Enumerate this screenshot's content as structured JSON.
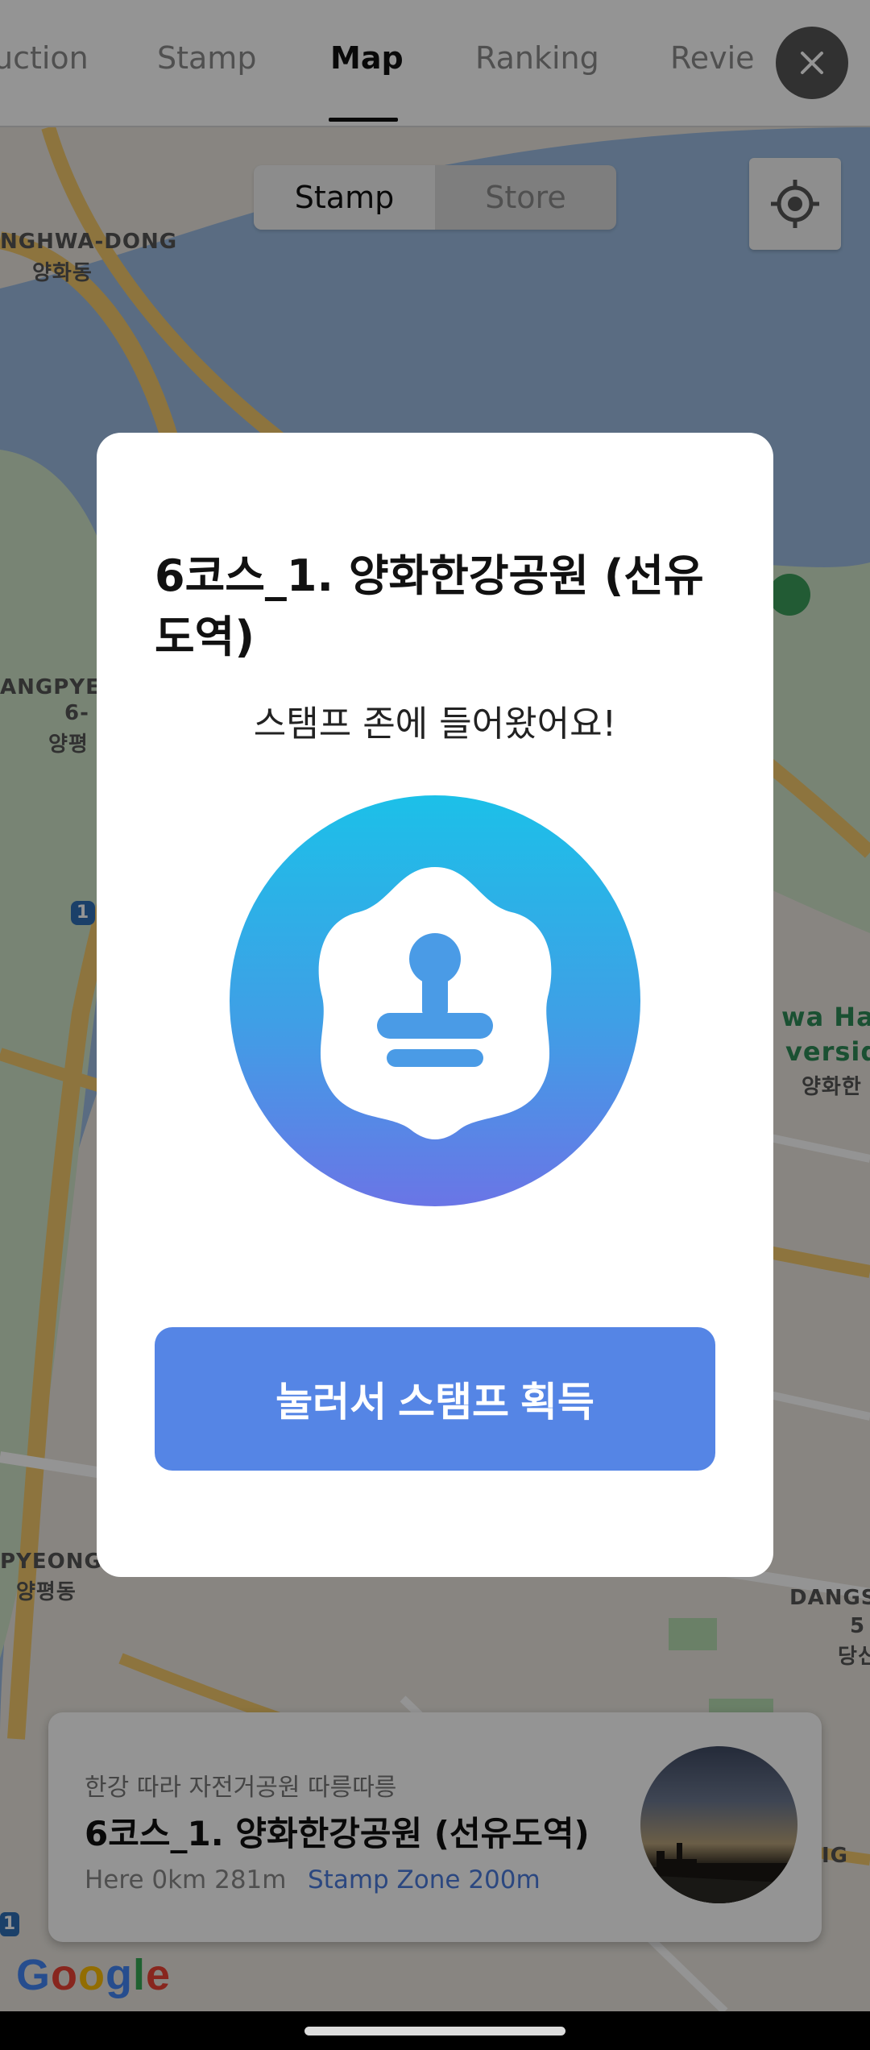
{
  "topnav": {
    "tabs": [
      {
        "label": "uction"
      },
      {
        "label": "Stamp"
      },
      {
        "label": "Map"
      },
      {
        "label": "Ranking"
      },
      {
        "label": "Revie"
      }
    ],
    "active_tab": "Map",
    "close_icon": "close-icon"
  },
  "map": {
    "toggle": {
      "stamp_label": "Stamp",
      "store_label": "Store",
      "selected": "Stamp"
    },
    "locate_icon": "crosshair-icon",
    "labels": {
      "l1": "NGHWA-DONG",
      "l2": "양화동",
      "l3": "ANGPYEO",
      "l4": "6-",
      "l5": "양평",
      "l6": "wa Hang",
      "l7": "verside",
      "l8": "양화한",
      "l9": "PYEONG-",
      "l10": "양평동",
      "l11": "DANGS",
      "l12": "5",
      "l13": "당신",
      "l14": "IG",
      "route1": "1",
      "route2": "1"
    },
    "google": [
      "G",
      "o",
      "o",
      "g",
      "l",
      "e"
    ]
  },
  "bottom_card": {
    "subtitle": "한강 따라 자전거공원 따릉따릉",
    "title": "6코스_1. 양화한강공원 (선유도역)",
    "distance": "Here 0km 281m",
    "zone": "Stamp Zone 200m"
  },
  "modal": {
    "title": "6코스_1. 양화한강공원 (선유도역)",
    "message": "스탬프 존에 들어왔어요!",
    "stamp_icon": "stamp-icon",
    "button_label": "눌러서 스탬프 획득"
  },
  "colors": {
    "accent": "#5585e5",
    "zone_text": "#4a7bdc",
    "badge_top": "#1cc0e8",
    "badge_bottom": "#6a75e6"
  }
}
